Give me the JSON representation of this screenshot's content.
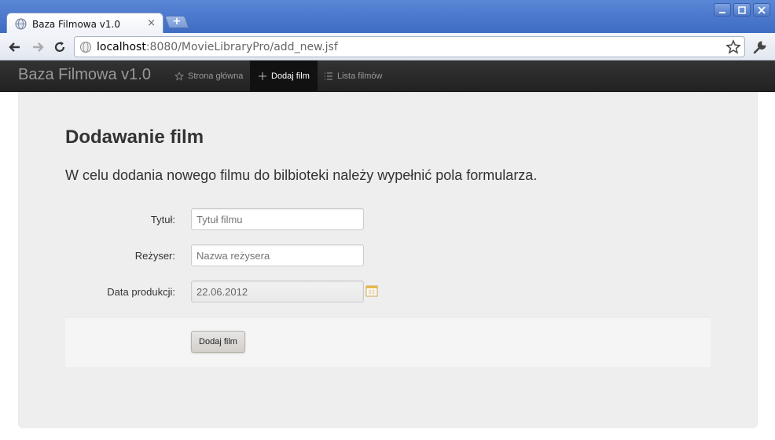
{
  "browser": {
    "tab_title": "Baza Filmowa v1.0",
    "tab_close": "×",
    "new_tab": "+",
    "url_host": "localhost",
    "url_rest": ":8080/MovieLibraryPro/add_new.jsf"
  },
  "navbar": {
    "brand": "Baza Filmowa v1.0",
    "items": [
      {
        "label": "Strona główna",
        "icon": "star-icon",
        "active": false
      },
      {
        "label": "Dodaj film",
        "icon": "plus-icon",
        "active": true
      },
      {
        "label": "Lista filmów",
        "icon": "list-icon",
        "active": false
      }
    ]
  },
  "page": {
    "heading": "Dodawanie film",
    "lead": "W celu dodania nowego filmu do bilbioteki należy wypełnić pola formularza."
  },
  "form": {
    "title_label": "Tytuł:",
    "title_placeholder": "Tytuł filmu",
    "director_label": "Reżyser:",
    "director_placeholder": "Nazwa reżysera",
    "date_label": "Data produkcji:",
    "date_value": "22.06.2012",
    "submit_label": "Dodaj film"
  },
  "colors": {
    "window_frame": "#3d6cc3",
    "navbar_bg": "#222222",
    "well_bg": "#eeeeee"
  }
}
